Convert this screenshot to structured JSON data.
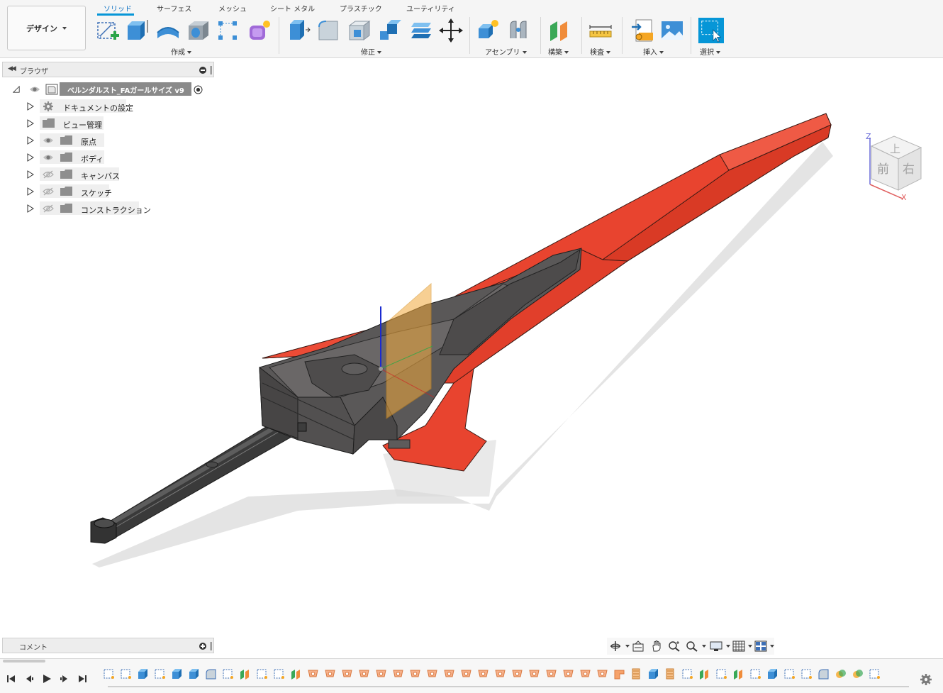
{
  "workspace": {
    "label": "デザイン"
  },
  "tabs": [
    {
      "label": "ソリッド",
      "active": true
    },
    {
      "label": "サーフェス",
      "active": false
    },
    {
      "label": "メッシュ",
      "active": false
    },
    {
      "label": "シート メタル",
      "active": false
    },
    {
      "label": "プラスチック",
      "active": false
    },
    {
      "label": "ユーティリティ",
      "active": false
    }
  ],
  "tool_groups": {
    "create": "作成",
    "modify": "修正",
    "assemble": "アセンブリ",
    "construct": "構築",
    "inspect": "検査",
    "insert": "挿入",
    "select": "選択"
  },
  "browser": {
    "title": "ブラウザ",
    "root": {
      "label": "ベルンダルスト_FAガールサイズ v9"
    },
    "items": [
      {
        "label": "ドキュメントの設定",
        "icon": "gear-icon",
        "visible": null
      },
      {
        "label": "ビュー管理",
        "icon": "folder-icon",
        "visible": null
      },
      {
        "label": "原点",
        "icon": "folder-icon",
        "visible": true
      },
      {
        "label": "ボディ",
        "icon": "folder-icon",
        "visible": true
      },
      {
        "label": "キャンバス",
        "icon": "folder-icon",
        "visible": false
      },
      {
        "label": "スケッチ",
        "icon": "folder-icon",
        "visible": false
      },
      {
        "label": "コンストラクション",
        "icon": "folder-icon",
        "visible": false
      }
    ]
  },
  "comments": {
    "title": "コメント"
  },
  "viewcube": {
    "top": "上",
    "front": "前",
    "right": "右",
    "axis_z": "Z",
    "axis_x": "X"
  },
  "colors": {
    "accent": "#0696d7",
    "blade_red": "#e8442f",
    "body_dark": "#5a5858",
    "plane_orange": "#f2a93b"
  },
  "timeline": {
    "features": [
      "sketch",
      "sketch",
      "extrude",
      "sketch",
      "extrude",
      "extrude",
      "fillet",
      "sketch",
      "construct",
      "sketch",
      "sketch",
      "construct",
      "split",
      "split",
      "split",
      "split",
      "split",
      "split",
      "split",
      "split",
      "split",
      "split",
      "split",
      "split",
      "split",
      "split",
      "split",
      "split",
      "split",
      "split",
      "corner",
      "mirror",
      "extrude",
      "mirror",
      "sketch",
      "construct",
      "sketch",
      "construct",
      "sketch",
      "extrude",
      "sketch",
      "sketch",
      "fillet",
      "combine",
      "combine",
      "sketch"
    ]
  }
}
